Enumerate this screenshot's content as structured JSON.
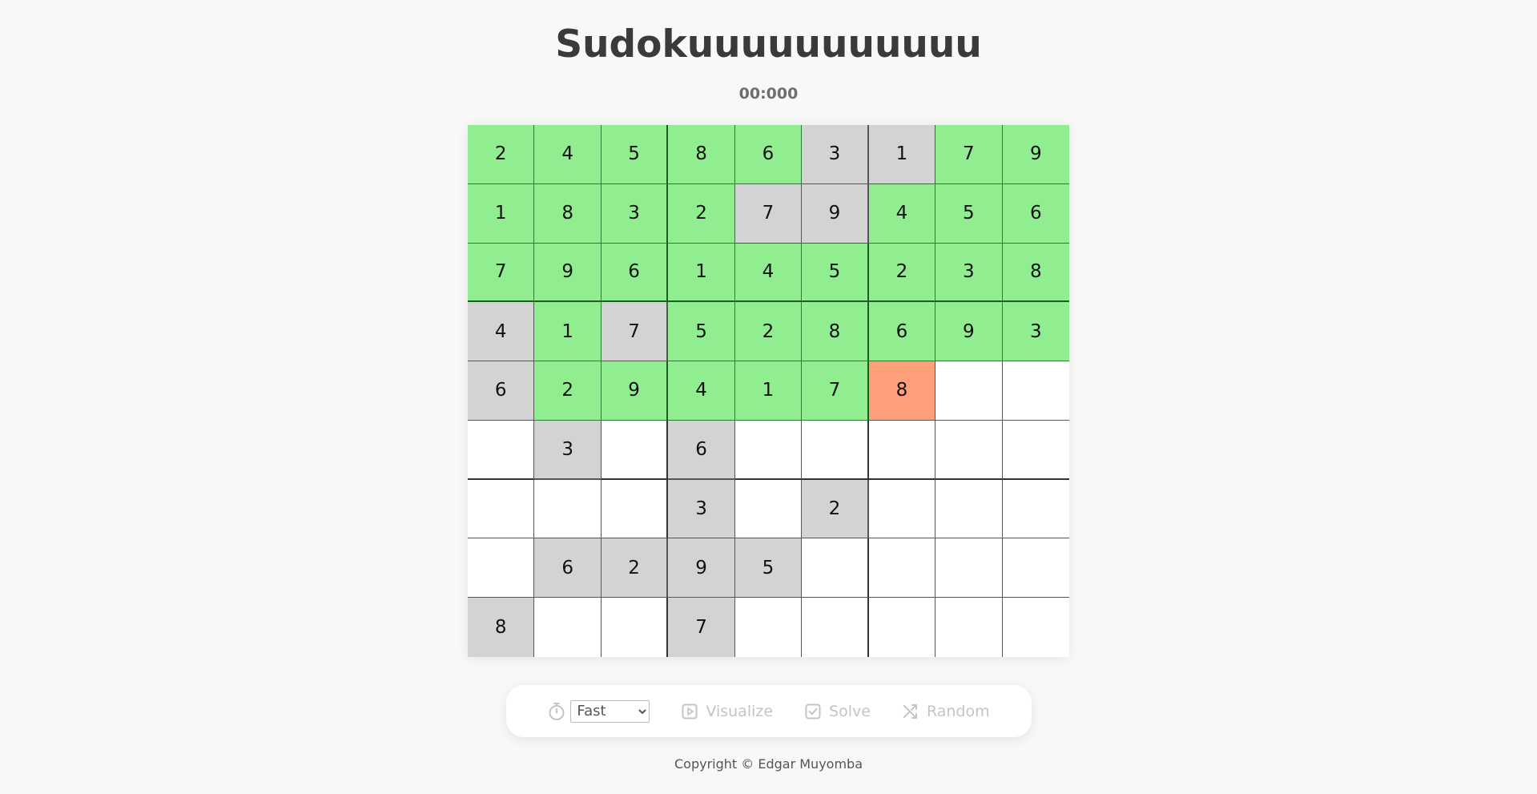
{
  "header": {
    "title": "Sudokuuuuuuuuuuu",
    "timer": "00:000"
  },
  "colors": {
    "solved": "#90ee90",
    "given": "#d3d3d3",
    "current": "#ffa07a",
    "empty": "#ffffff"
  },
  "board": {
    "rows": [
      [
        {
          "v": "2",
          "s": "solved"
        },
        {
          "v": "4",
          "s": "solved"
        },
        {
          "v": "5",
          "s": "solved"
        },
        {
          "v": "8",
          "s": "solved"
        },
        {
          "v": "6",
          "s": "solved"
        },
        {
          "v": "3",
          "s": "fixed"
        },
        {
          "v": "1",
          "s": "fixed"
        },
        {
          "v": "7",
          "s": "solved"
        },
        {
          "v": "9",
          "s": "solved"
        }
      ],
      [
        {
          "v": "1",
          "s": "solved"
        },
        {
          "v": "8",
          "s": "solved"
        },
        {
          "v": "3",
          "s": "solved"
        },
        {
          "v": "2",
          "s": "solved"
        },
        {
          "v": "7",
          "s": "fixed"
        },
        {
          "v": "9",
          "s": "fixed"
        },
        {
          "v": "4",
          "s": "solved"
        },
        {
          "v": "5",
          "s": "solved"
        },
        {
          "v": "6",
          "s": "solved"
        }
      ],
      [
        {
          "v": "7",
          "s": "solved"
        },
        {
          "v": "9",
          "s": "solved"
        },
        {
          "v": "6",
          "s": "solved"
        },
        {
          "v": "1",
          "s": "solved"
        },
        {
          "v": "4",
          "s": "solved"
        },
        {
          "v": "5",
          "s": "solved"
        },
        {
          "v": "2",
          "s": "solved"
        },
        {
          "v": "3",
          "s": "solved"
        },
        {
          "v": "8",
          "s": "solved"
        }
      ],
      [
        {
          "v": "4",
          "s": "fixed"
        },
        {
          "v": "1",
          "s": "solved"
        },
        {
          "v": "7",
          "s": "fixed"
        },
        {
          "v": "5",
          "s": "solved"
        },
        {
          "v": "2",
          "s": "solved"
        },
        {
          "v": "8",
          "s": "solved"
        },
        {
          "v": "6",
          "s": "solved"
        },
        {
          "v": "9",
          "s": "solved"
        },
        {
          "v": "3",
          "s": "solved"
        }
      ],
      [
        {
          "v": "6",
          "s": "fixed"
        },
        {
          "v": "2",
          "s": "solved"
        },
        {
          "v": "9",
          "s": "solved"
        },
        {
          "v": "4",
          "s": "solved"
        },
        {
          "v": "1",
          "s": "solved"
        },
        {
          "v": "7",
          "s": "solved"
        },
        {
          "v": "8",
          "s": "current"
        },
        {
          "v": "",
          "s": "empty"
        },
        {
          "v": "",
          "s": "empty"
        }
      ],
      [
        {
          "v": "",
          "s": "empty"
        },
        {
          "v": "3",
          "s": "fixed"
        },
        {
          "v": "",
          "s": "empty"
        },
        {
          "v": "6",
          "s": "fixed"
        },
        {
          "v": "",
          "s": "empty"
        },
        {
          "v": "",
          "s": "empty"
        },
        {
          "v": "",
          "s": "empty"
        },
        {
          "v": "",
          "s": "empty"
        },
        {
          "v": "",
          "s": "empty"
        }
      ],
      [
        {
          "v": "",
          "s": "empty"
        },
        {
          "v": "",
          "s": "empty"
        },
        {
          "v": "",
          "s": "empty"
        },
        {
          "v": "3",
          "s": "fixed"
        },
        {
          "v": "",
          "s": "empty"
        },
        {
          "v": "2",
          "s": "fixed"
        },
        {
          "v": "",
          "s": "empty"
        },
        {
          "v": "",
          "s": "empty"
        },
        {
          "v": "",
          "s": "empty"
        }
      ],
      [
        {
          "v": "",
          "s": "empty"
        },
        {
          "v": "6",
          "s": "fixed"
        },
        {
          "v": "2",
          "s": "fixed"
        },
        {
          "v": "9",
          "s": "fixed"
        },
        {
          "v": "5",
          "s": "fixed"
        },
        {
          "v": "",
          "s": "empty"
        },
        {
          "v": "",
          "s": "empty"
        },
        {
          "v": "",
          "s": "empty"
        },
        {
          "v": "",
          "s": "empty"
        }
      ],
      [
        {
          "v": "8",
          "s": "fixed"
        },
        {
          "v": "",
          "s": "empty"
        },
        {
          "v": "",
          "s": "empty"
        },
        {
          "v": "7",
          "s": "fixed"
        },
        {
          "v": "",
          "s": "empty"
        },
        {
          "v": "",
          "s": "empty"
        },
        {
          "v": "",
          "s": "empty"
        },
        {
          "v": "",
          "s": "empty"
        },
        {
          "v": "",
          "s": "empty"
        }
      ]
    ]
  },
  "toolbar": {
    "speed_icon": "stopwatch-icon",
    "speed_selected": "Fast",
    "speed_options": [
      "Fast"
    ],
    "visualize_icon": "play-icon",
    "visualize_label": "Visualize",
    "solve_icon": "checkbox-icon",
    "solve_label": "Solve",
    "random_icon": "shuffle-icon",
    "random_label": "Random"
  },
  "footer": {
    "copyright": "Copyright © Edgar Muyomba"
  }
}
